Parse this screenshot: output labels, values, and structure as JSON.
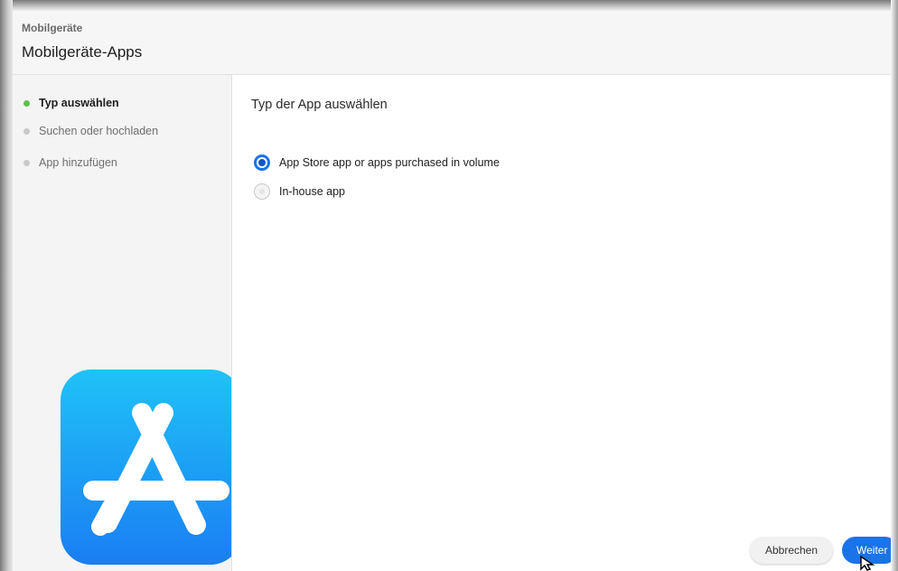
{
  "header": {
    "breadcrumb": "Mobilgeräte",
    "title": "Mobilgeräte-Apps"
  },
  "sidebar": {
    "steps": [
      {
        "label": "Typ auswählen",
        "active": true
      },
      {
        "label": "Suchen oder hochladen",
        "active": false
      },
      {
        "label": "App hinzufügen",
        "active": false
      }
    ]
  },
  "main": {
    "section_title": "Typ der App auswählen",
    "options": [
      {
        "label": "App Store app or apps purchased in volume",
        "selected": true
      },
      {
        "label": "In-house app",
        "selected": false
      }
    ]
  },
  "footer": {
    "cancel_label": "Abbrechen",
    "next_label": "Weiter"
  },
  "colors": {
    "accent": "#1a73e8",
    "active_step": "#5fbf4d",
    "icon_gradient_top": "#1fc2f7",
    "icon_gradient_bottom": "#1a7ef3"
  },
  "icons": [
    "app-store-icon",
    "cursor-icon"
  ]
}
